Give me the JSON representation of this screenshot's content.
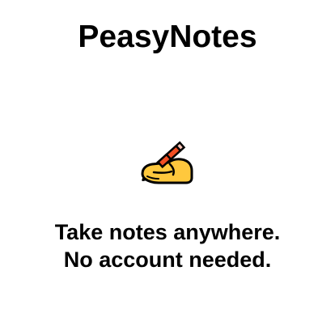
{
  "app": {
    "title": "PeasyNotes"
  },
  "hero": {
    "icon": "writing-hand-icon"
  },
  "tagline": {
    "line1": "Take notes anywhere.",
    "line2": "No account needed."
  },
  "colors": {
    "background": "#ffffff",
    "text": "#000000",
    "hand": "#ffc83d",
    "pencil": "#f04e23"
  }
}
